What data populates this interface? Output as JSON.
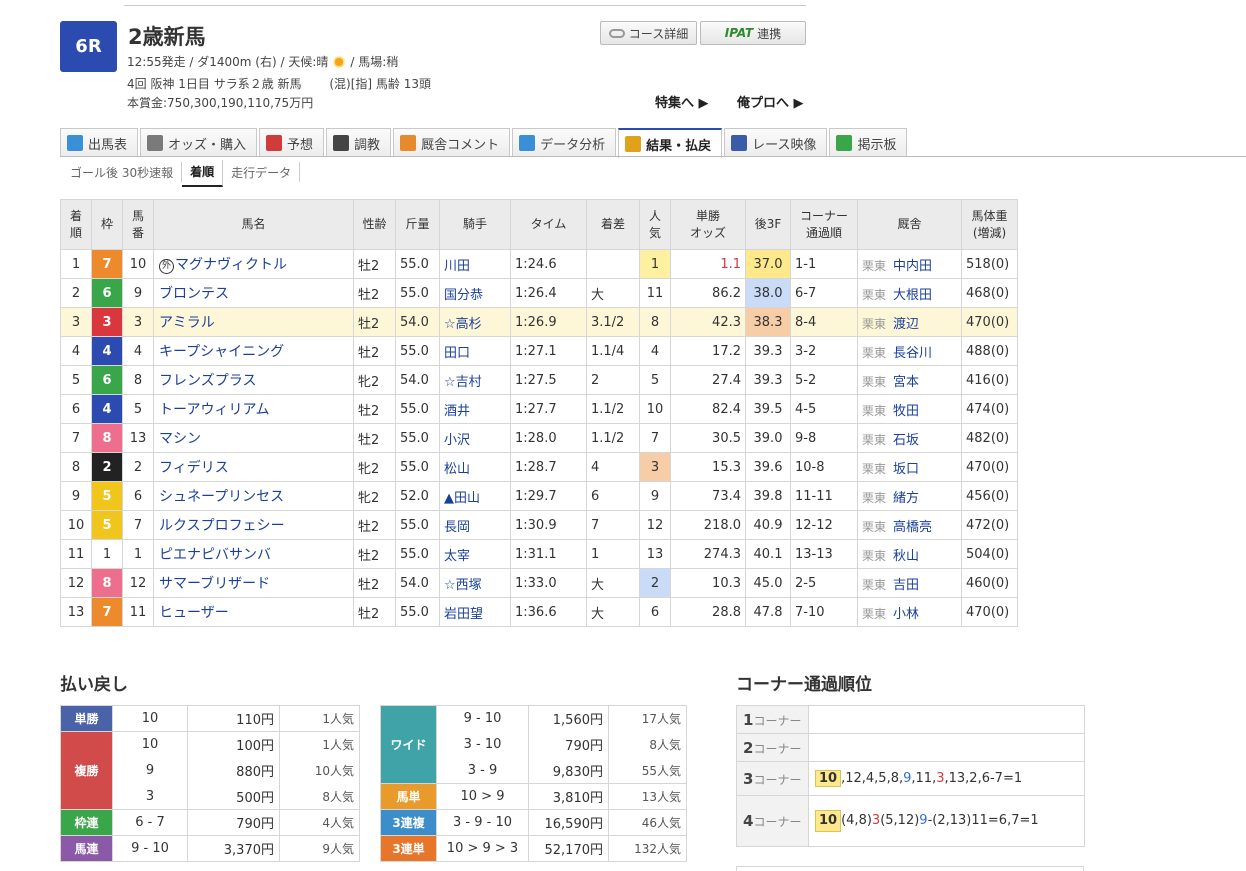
{
  "race": {
    "number": "6R",
    "name": "2歳新馬",
    "info_before_weather": "12:55発走 / ダ1400m (右) / 天候:晴",
    "info_after_weather": "/ 馬場:稍",
    "info2": "4回 阪神 1日目 サラ系２歳 新馬 　　(混)[指] 馬齢 13頭",
    "prize": "本賞金:750,300,190,110,75万円"
  },
  "buttons": {
    "course": "コース詳細",
    "ipat_logo": "IPAT",
    "ipat": "連携"
  },
  "links": {
    "feature": "特集へ ▶",
    "orepro": "俺プロへ ▶"
  },
  "tabs": [
    {
      "label": "出馬表",
      "icon": "table-icon",
      "color": "#3a8fd6"
    },
    {
      "label": "オッズ・購入",
      "icon": "odds-icon",
      "color": "#7a7a7a"
    },
    {
      "label": "予想",
      "icon": "target-icon",
      "color": "#d03b3b"
    },
    {
      "label": "調教",
      "icon": "stopwatch-icon",
      "color": "#444444"
    },
    {
      "label": "厩舎コメント",
      "icon": "stable-icon",
      "color": "#e58b2e"
    },
    {
      "label": "データ分析",
      "icon": "bar-chart-icon",
      "color": "#3a8fd6"
    },
    {
      "label": "結果・払戻",
      "icon": "coins-icon",
      "color": "#e0a21a"
    },
    {
      "label": "レース映像",
      "icon": "video-icon",
      "color": "#3b5aa8"
    },
    {
      "label": "掲示板",
      "icon": "chat-icon",
      "color": "#3aa64a"
    }
  ],
  "subnav": [
    "ゴール後 30秒速報",
    "着順",
    "走行データ"
  ],
  "results": {
    "headers": [
      "着\n順",
      "枠",
      "馬\n番",
      "馬名",
      "性齢",
      "斤量",
      "騎手",
      "タイム",
      "着差",
      "人\n気",
      "単勝\nオッズ",
      "後3F",
      "コーナー\n通過順",
      "厩舎",
      "馬体重\n(増減)"
    ],
    "rows": [
      {
        "rank": "1",
        "waku": "7",
        "num": "10",
        "name": "マグナヴィクトル",
        "mark": "外",
        "sex": "牡2",
        "weight": "55.0",
        "jockey": "川田",
        "time": "1:24.6",
        "margin": "",
        "pop": "1",
        "odds": "1.1",
        "last3f": "37.0",
        "corner": "1-1",
        "area": "栗東",
        "trainer": "中内田",
        "body": "518(0)"
      },
      {
        "rank": "2",
        "waku": "6",
        "num": "9",
        "name": "ブロンテス",
        "mark": "",
        "sex": "牡2",
        "weight": "55.0",
        "jockey": "国分恭",
        "time": "1:26.4",
        "margin": "大",
        "pop": "11",
        "odds": "86.2",
        "last3f": "38.0",
        "corner": "6-7",
        "area": "栗東",
        "trainer": "大根田",
        "body": "468(0)"
      },
      {
        "rank": "3",
        "waku": "3",
        "num": "3",
        "name": "アミラル",
        "mark": "",
        "sex": "牡2",
        "weight": "54.0",
        "jockey": "☆高杉",
        "time": "1:26.9",
        "margin": "3.1/2",
        "pop": "8",
        "odds": "42.3",
        "last3f": "38.3",
        "corner": "8-4",
        "area": "栗東",
        "trainer": "渡辺",
        "body": "470(0)"
      },
      {
        "rank": "4",
        "waku": "4",
        "num": "4",
        "name": "キープシャイニング",
        "mark": "",
        "sex": "牡2",
        "weight": "55.0",
        "jockey": "田口",
        "time": "1:27.1",
        "margin": "1.1/4",
        "pop": "4",
        "odds": "17.2",
        "last3f": "39.3",
        "corner": "3-2",
        "area": "栗東",
        "trainer": "長谷川",
        "body": "488(0)"
      },
      {
        "rank": "5",
        "waku": "6",
        "num": "8",
        "name": "フレンズプラス",
        "mark": "",
        "sex": "牝2",
        "weight": "54.0",
        "jockey": "☆吉村",
        "time": "1:27.5",
        "margin": "2",
        "pop": "5",
        "odds": "27.4",
        "last3f": "39.3",
        "corner": "5-2",
        "area": "栗東",
        "trainer": "宮本",
        "body": "416(0)"
      },
      {
        "rank": "6",
        "waku": "4",
        "num": "5",
        "name": "トーアウィリアム",
        "mark": "",
        "sex": "牡2",
        "weight": "55.0",
        "jockey": "酒井",
        "time": "1:27.7",
        "margin": "1.1/2",
        "pop": "10",
        "odds": "82.4",
        "last3f": "39.5",
        "corner": "4-5",
        "area": "栗東",
        "trainer": "牧田",
        "body": "474(0)"
      },
      {
        "rank": "7",
        "waku": "8",
        "num": "13",
        "name": "マシン",
        "mark": "",
        "sex": "牡2",
        "weight": "55.0",
        "jockey": "小沢",
        "time": "1:28.0",
        "margin": "1.1/2",
        "pop": "7",
        "odds": "30.5",
        "last3f": "39.0",
        "corner": "9-8",
        "area": "栗東",
        "trainer": "石坂",
        "body": "482(0)"
      },
      {
        "rank": "8",
        "waku": "2",
        "num": "2",
        "name": "フィデリス",
        "mark": "",
        "sex": "牝2",
        "weight": "55.0",
        "jockey": "松山",
        "time": "1:28.7",
        "margin": "4",
        "pop": "3",
        "odds": "15.3",
        "last3f": "39.6",
        "corner": "10-8",
        "area": "栗東",
        "trainer": "坂口",
        "body": "470(0)"
      },
      {
        "rank": "9",
        "waku": "5",
        "num": "6",
        "name": "シュネープリンセス",
        "mark": "",
        "sex": "牝2",
        "weight": "52.0",
        "jockey": "▲田山",
        "time": "1:29.7",
        "margin": "6",
        "pop": "9",
        "odds": "73.4",
        "last3f": "39.8",
        "corner": "11-11",
        "area": "栗東",
        "trainer": "緒方",
        "body": "456(0)"
      },
      {
        "rank": "10",
        "waku": "5",
        "num": "7",
        "name": "ルクスプロフェシー",
        "mark": "",
        "sex": "牡2",
        "weight": "55.0",
        "jockey": "長岡",
        "time": "1:30.9",
        "margin": "7",
        "pop": "12",
        "odds": "218.0",
        "last3f": "40.9",
        "corner": "12-12",
        "area": "栗東",
        "trainer": "高橋亮",
        "body": "472(0)"
      },
      {
        "rank": "11",
        "waku": "1",
        "num": "1",
        "name": "ピエナピバサンバ",
        "mark": "",
        "sex": "牡2",
        "weight": "55.0",
        "jockey": "太宰",
        "time": "1:31.1",
        "margin": "1",
        "pop": "13",
        "odds": "274.3",
        "last3f": "40.1",
        "corner": "13-13",
        "area": "栗東",
        "trainer": "秋山",
        "body": "504(0)"
      },
      {
        "rank": "12",
        "waku": "8",
        "num": "12",
        "name": "サマーブリザード",
        "mark": "",
        "sex": "牡2",
        "weight": "54.0",
        "jockey": "☆西塚",
        "time": "1:33.0",
        "margin": "大",
        "pop": "2",
        "odds": "10.3",
        "last3f": "45.0",
        "corner": "2-5",
        "area": "栗東",
        "trainer": "吉田",
        "body": "460(0)"
      },
      {
        "rank": "13",
        "waku": "7",
        "num": "11",
        "name": "ヒューザー",
        "mark": "",
        "sex": "牡2",
        "weight": "55.0",
        "jockey": "岩田望",
        "time": "1:36.6",
        "margin": "大",
        "pop": "6",
        "odds": "28.8",
        "last3f": "47.8",
        "corner": "7-10",
        "area": "栗東",
        "trainer": "小林",
        "body": "470(0)"
      }
    ]
  },
  "payout": {
    "title": "払い戻し",
    "left": [
      {
        "type": "単勝",
        "color": "#4a62a8",
        "rows": [
          [
            "10",
            "110円",
            "1人気"
          ]
        ]
      },
      {
        "type": "複勝",
        "color": "#d14b4b",
        "rows": [
          [
            "10",
            "100円",
            "1人気"
          ],
          [
            "9",
            "880円",
            "10人気"
          ],
          [
            "3",
            "500円",
            "8人気"
          ]
        ]
      },
      {
        "type": "枠連",
        "color": "#3aa64a",
        "rows": [
          [
            "6 - 7",
            "790円",
            "4人気"
          ]
        ]
      },
      {
        "type": "馬連",
        "color": "#8a5aa8",
        "rows": [
          [
            "9 - 10",
            "3,370円",
            "9人気"
          ]
        ]
      }
    ],
    "right": [
      {
        "type": "ワイド",
        "color": "#3fa3a8",
        "rows": [
          [
            "9 - 10",
            "1,560円",
            "17人気"
          ],
          [
            "3 - 10",
            "790円",
            "8人気"
          ],
          [
            "3 - 9",
            "9,830円",
            "55人気"
          ]
        ]
      },
      {
        "type": "馬単",
        "color": "#e89a2a",
        "rows": [
          [
            "10 > 9",
            "3,810円",
            "13人気"
          ]
        ]
      },
      {
        "type": "3連複",
        "color": "#3b8ec9",
        "rows": [
          [
            "3 - 9 - 10",
            "16,590円",
            "46人気"
          ]
        ]
      },
      {
        "type": "3連単",
        "color": "#e5762a",
        "rows": [
          [
            "10 > 9 > 3",
            "52,170円",
            "132人気"
          ]
        ]
      }
    ]
  },
  "corner": {
    "title": "コーナー通過順位",
    "label_suffix": "コーナー",
    "rows": [
      {
        "num": "1",
        "lead": "",
        "parts": []
      },
      {
        "num": "2",
        "lead": "",
        "parts": []
      },
      {
        "num": "3",
        "lead": "10",
        "parts": [
          [
            ",12,4,5,8,",
            ""
          ],
          [
            "9",
            "blue"
          ],
          [
            ",11,",
            ""
          ],
          [
            "3",
            "red"
          ],
          [
            ",13,2,6-7=1",
            ""
          ]
        ]
      },
      {
        "num": "4",
        "lead": "10",
        "parts": [
          [
            "(4,8)",
            ""
          ],
          [
            "3",
            "red"
          ],
          [
            "(5,12)",
            ""
          ],
          [
            "9",
            "blue"
          ],
          [
            "-(2,13)11=6,7=1",
            ""
          ]
        ]
      }
    ]
  },
  "colors": {
    "waku": {
      "1": "#ffffff",
      "2": "#222222",
      "3": "#d9363e",
      "4": "#2c4bb0",
      "5": "#f0c51c",
      "6": "#3aa64a",
      "7": "#ec8a2c",
      "8": "#ee6f8d"
    },
    "pop1": "#fdf0a0",
    "pop2": "#c9dbf7",
    "pop3": "#f6cda6",
    "f3_1": "#fde98b",
    "f3_2": "#c9dbf7",
    "f3_3": "#f6cda6"
  }
}
